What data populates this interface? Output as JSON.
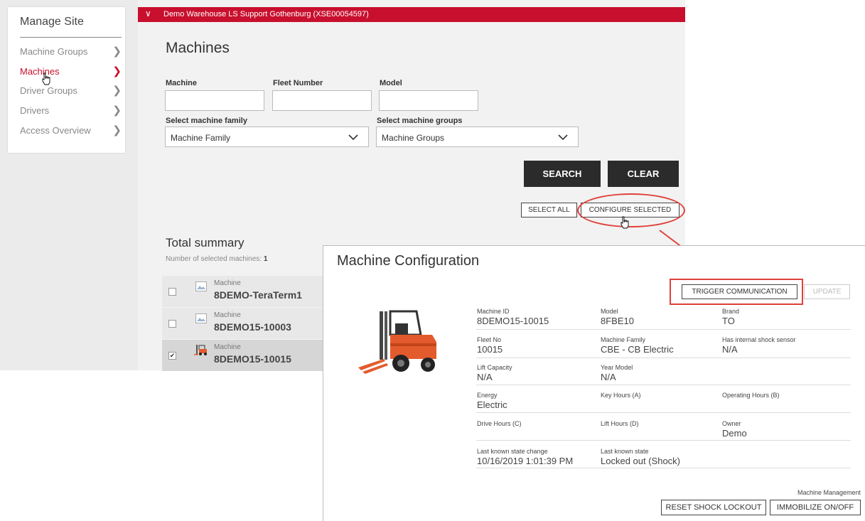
{
  "sidebar": {
    "title": "Manage Site",
    "items": [
      {
        "label": "Machine Groups",
        "active": false
      },
      {
        "label": "Machines",
        "active": true
      },
      {
        "label": "Driver Groups",
        "active": false
      },
      {
        "label": "Drivers",
        "active": false
      },
      {
        "label": "Access Overview",
        "active": false
      }
    ]
  },
  "header": {
    "site_name": "Demo Warehouse LS Support Gothenburg (XSE00054597)"
  },
  "page": {
    "title": "Machines"
  },
  "filters": {
    "machine_label": "Machine",
    "machine_value": "",
    "fleet_label": "Fleet Number",
    "fleet_value": "",
    "model_label": "Model",
    "model_value": "",
    "family_label": "Select machine family",
    "family_value": "Machine Family",
    "groups_label": "Select machine groups",
    "groups_value": "Machine Groups"
  },
  "actions": {
    "search": "SEARCH",
    "clear": "CLEAR",
    "select_all": "SELECT ALL",
    "configure_selected": "CONFIGURE SELECTED"
  },
  "summary": {
    "title": "Total summary",
    "selected_label": "Number of selected machines: ",
    "selected_count": "1"
  },
  "machines": [
    {
      "label": "Machine",
      "name": "8DEMO-TeraTerm1",
      "checked": false
    },
    {
      "label": "Machine",
      "name": "8DEMO15-10003",
      "checked": false
    },
    {
      "label": "Machine",
      "name": "8DEMO15-10015",
      "checked": true
    }
  ],
  "modal": {
    "title": "Machine Configuration",
    "trigger": "TRIGGER COMMUNICATION",
    "update": "UPDATE",
    "fields": {
      "machine_id_label": "Machine ID",
      "machine_id": "8DEMO15-10015",
      "model_label": "Model",
      "model": "8FBE10",
      "brand_label": "Brand",
      "brand": "TO",
      "fleet_label": "Fleet No",
      "fleet": "10015",
      "family_label": "Machine Family",
      "family": "CBE - CB Electric",
      "shock_label": "Has internal shock sensor",
      "shock": "N/A",
      "lift_cap_label": "Lift Capacity",
      "lift_cap": "N/A",
      "year_label": "Year Model",
      "year": "N/A",
      "energy_label": "Energy",
      "energy": "Electric",
      "key_hours_label": "Key Hours (A)",
      "op_hours_label": "Operating Hours (B)",
      "drive_hours_label": "Drive Hours (C)",
      "lift_hours_label": "Lift Hours (D)",
      "owner_label": "Owner",
      "owner": "Demo",
      "state_change_label": "Last known state change",
      "state_change": "10/16/2019 1:01:39 PM",
      "state_label": "Last known state",
      "state": "Locked out (Shock)"
    },
    "management_label": "Machine Management",
    "reset_shock": "RESET SHOCK LOCKOUT",
    "immobilize": "IMMOBILIZE ON/OFF"
  },
  "colors": {
    "brand_red": "#c8102e",
    "annotation_red": "#e0403a",
    "dark_button": "#2b2b2b"
  }
}
